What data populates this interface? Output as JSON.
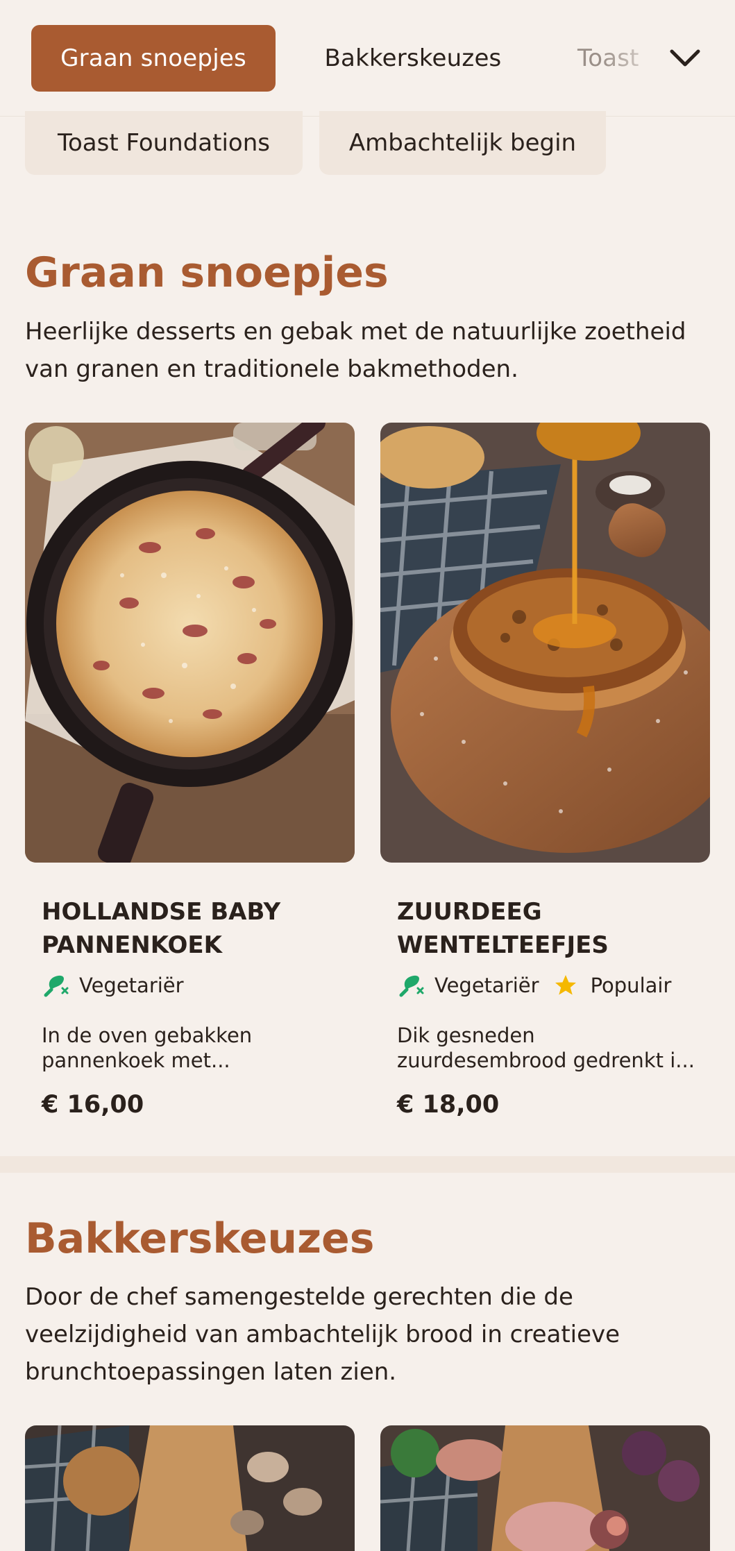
{
  "nav": {
    "tabs": [
      "Graan snoepjes",
      "Bakkerskeuzes",
      "Toast"
    ],
    "active_index": 0,
    "more_icon": "chevron-down-icon"
  },
  "chips": [
    "Toast Foundations",
    "Ambachtelijk begin"
  ],
  "sections": [
    {
      "title": "Graan snoepjes",
      "description": "Heerlijke desserts en gebak met de natuurlijke zoetheid van granen en traditionele bakmethoden.",
      "items": [
        {
          "title": "Hollandse Baby Pannenkoek",
          "tags": [
            {
              "icon": "vegetarian-icon",
              "label": "Vegetariër"
            }
          ],
          "description": "In de oven gebakken pannenkoek met...",
          "price": "€ 16,00"
        },
        {
          "title": "Zuurdeeg Wentelteefjes",
          "tags": [
            {
              "icon": "vegetarian-icon",
              "label": "Vegetariër"
            },
            {
              "icon": "star-icon",
              "label": "Populair"
            }
          ],
          "description": "Dik gesneden zuurdesembrood gedrenkt i...",
          "price": "€ 18,00"
        }
      ]
    },
    {
      "title": "Bakkerskeuzes",
      "description": "Door de chef samengestelde gerechten die de veelzijdigheid van ambachtelijk brood in creatieve brunchtoepassingen laten zien."
    }
  ],
  "colors": {
    "accent": "#a95b31",
    "background": "#f6f0eb",
    "chip_bg": "#f0e6dd",
    "vegetarian": "#1fa86a",
    "star": "#f5b800"
  }
}
